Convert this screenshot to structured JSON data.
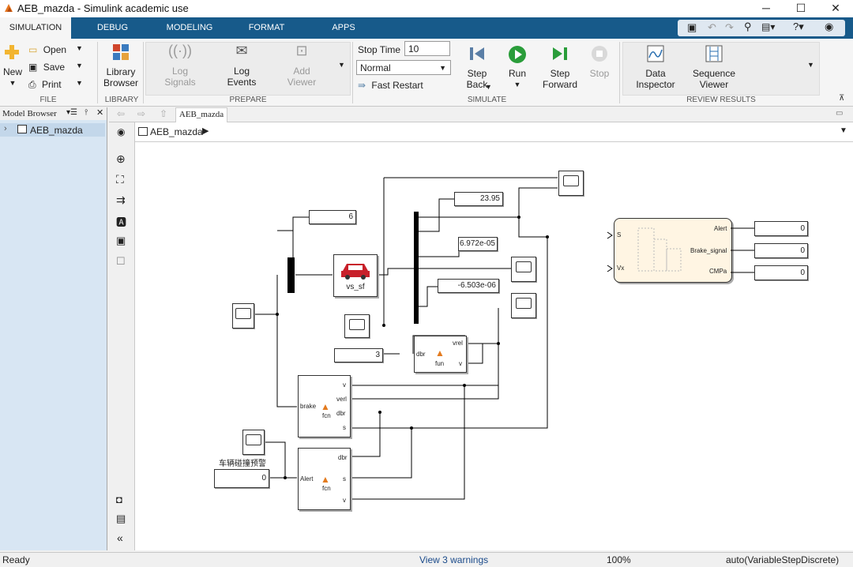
{
  "window": {
    "title": "AEB_mazda - Simulink academic use"
  },
  "tabs": [
    "SIMULATION",
    "DEBUG",
    "MODELING",
    "FORMAT",
    "APPS"
  ],
  "toolstrip": {
    "file": {
      "new": "New",
      "open": "Open",
      "save": "Save",
      "print": "Print",
      "label": "FILE"
    },
    "library": {
      "browser_line1": "Library",
      "browser_line2": "Browser",
      "label": "LIBRARY"
    },
    "prepare": {
      "log_signals_1": "Log",
      "log_signals_2": "Signals",
      "log_events_1": "Log",
      "log_events_2": "Events",
      "add_viewer_1": "Add",
      "add_viewer_2": "Viewer",
      "label": "PREPARE"
    },
    "simulate": {
      "stop_time_label": "Stop Time",
      "stop_time_value": "10",
      "mode": "Normal",
      "fast_restart": "Fast Restart",
      "step_back_1": "Step",
      "step_back_2": "Back",
      "run": "Run",
      "step_forward_1": "Step",
      "step_forward_2": "Forward",
      "stop": "Stop",
      "label": "SIMULATE"
    },
    "review": {
      "data_inspector_1": "Data",
      "data_inspector_2": "Inspector",
      "sequence_viewer_1": "Sequence",
      "sequence_viewer_2": "Viewer",
      "label": "REVIEW RESULTS"
    }
  },
  "model_browser": {
    "header": "Model Browser",
    "item": "AEB_mazda"
  },
  "editor": {
    "tab": "AEB_mazda",
    "breadcrumb": "AEB_mazda"
  },
  "diagram": {
    "displays": {
      "d6": "6",
      "d2395": "23.95",
      "d6972": "6.972e-05",
      "d6503": "-6.503e-06",
      "d3": "3",
      "d0_alert": "0",
      "d0_a": "0",
      "d0_b": "0",
      "d0_c": "0"
    },
    "vs_sf": {
      "label": "vs_sf"
    },
    "fun_block": {
      "in1": "dbr",
      "out1": "vrel",
      "out2": "v",
      "name": "fun"
    },
    "brake_block": {
      "name": "brake",
      "fn": "fcn",
      "p1": "v",
      "p2": "verl",
      "p3": "dbr",
      "p4": "s"
    },
    "alert_block": {
      "name": "Alert",
      "fn": "fcn",
      "p1": "dbr",
      "p2": "s",
      "p3": "v"
    },
    "chart_block": {
      "in1": "S",
      "in2": "Vx",
      "out1": "Alert",
      "out2": "Brake_signal",
      "out3": "CMPa"
    },
    "chinese_label": "车辆碰撞预警"
  },
  "status": {
    "ready": "Ready",
    "warnings": "View 3 warnings",
    "zoom": "100%",
    "solver": "auto(VariableStepDiscrete)"
  }
}
